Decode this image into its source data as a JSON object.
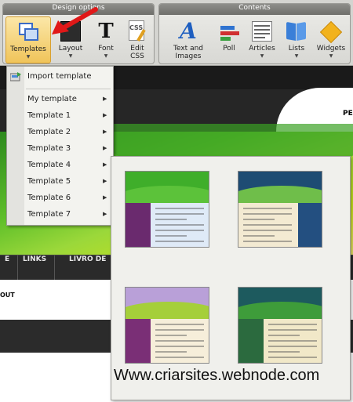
{
  "toolbar": {
    "design_group_title": "Design options",
    "contents_group_title": "Contents",
    "buttons": {
      "templates": "Templates",
      "layout": "Layout",
      "font": "Font",
      "edit_css": "Edit\nCSS",
      "text_images": "Text and\nImages",
      "poll": "Poll",
      "articles": "Articles",
      "lists": "Lists",
      "widgets": "Widgets"
    },
    "dropdown_arrow": "▼"
  },
  "menu": {
    "import_label": "Import template",
    "items": [
      {
        "label": "My template"
      },
      {
        "label": "Template 1"
      },
      {
        "label": "Template 2"
      },
      {
        "label": "Template 3"
      },
      {
        "label": "Template 4"
      },
      {
        "label": "Template 5"
      },
      {
        "label": "Template 6"
      },
      {
        "label": "Template 7"
      }
    ],
    "submenu_arrow": "▶"
  },
  "site": {
    "header_text": "PE",
    "nav": [
      "E",
      "LINKS",
      "LIVRO DE"
    ],
    "body_text": "OUT"
  },
  "preview": {
    "thumbnails": [
      {
        "name": "green-purple",
        "header": "#3fae2a",
        "hill": "#5cc23a",
        "side": "#6a2a6e",
        "main": "#dfeaf7"
      },
      {
        "name": "navy-blue",
        "header": "#1e4c73",
        "hill": "#6fbe4a",
        "side": "#234f80",
        "main": "#f3ead2"
      },
      {
        "name": "purple-lime",
        "header": "#b9a0d8",
        "hill": "#a5cf3a",
        "side": "#7a2f76",
        "main": "#f6eeda"
      },
      {
        "name": "teal-orange",
        "header": "#1d5a5e",
        "hill": "#3e9c3a",
        "side": "#2b6a3e",
        "main": "#f1e8c8"
      }
    ]
  },
  "watermark": "Www.criarsites.webnode.com",
  "colors": {
    "active_button": "#f0c45a",
    "annotation_arrow": "#e01818"
  }
}
